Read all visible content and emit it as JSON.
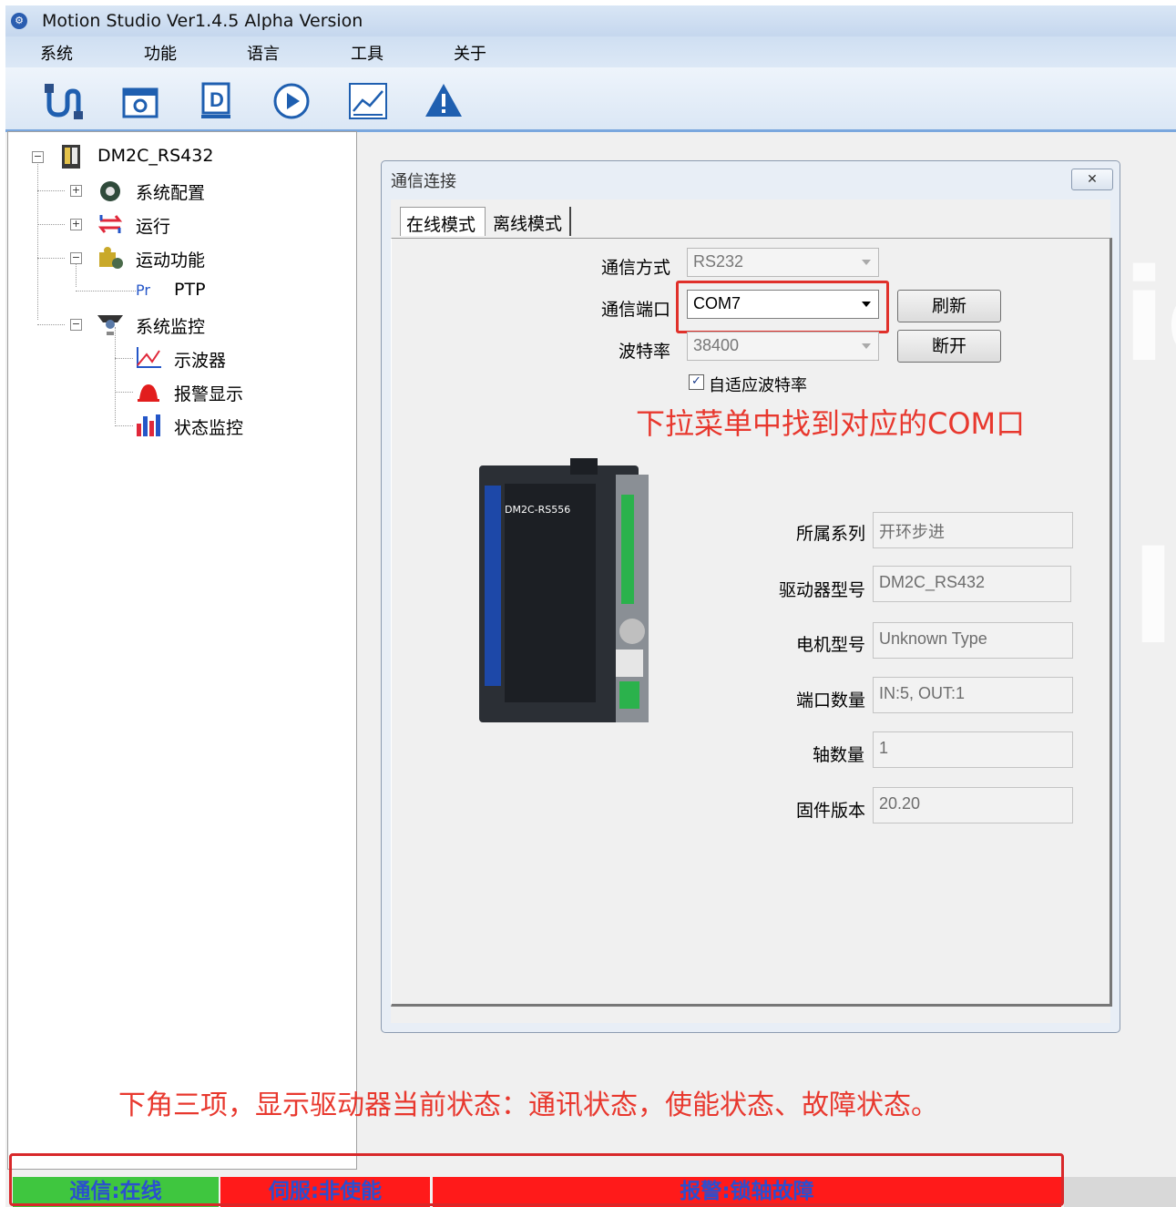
{
  "window": {
    "title": "Motion Studio  Ver1.4.5 Alpha Version",
    "app_icon": "motion-studio-logo"
  },
  "menu": {
    "items": [
      "系统",
      "功能",
      "语言",
      "工具",
      "关于"
    ]
  },
  "toolbar": {
    "icons": [
      "connect-icon",
      "device-settings-icon",
      "d-mode-icon",
      "run-icon",
      "chart-icon",
      "alarm-icon"
    ]
  },
  "tree": {
    "root": "DM2C_RS432",
    "items": {
      "sys_config": "系统配置",
      "run": "运行",
      "motion": "运动功能",
      "ptp_prefix": "Pr",
      "ptp": "PTP",
      "monitor": "系统监控",
      "scope": "示波器",
      "alarm_display": "报警显示",
      "status_monitor": "状态监控"
    }
  },
  "dialog": {
    "title": "通信连接",
    "close": "✕",
    "tabs": {
      "online": "在线模式",
      "offline": "离线模式"
    },
    "comm_mode": {
      "label": "通信方式",
      "value": "RS232"
    },
    "comm_port": {
      "label": "通信端口",
      "value": "COM7"
    },
    "baud": {
      "label": "波特率",
      "value": "38400"
    },
    "buttons": {
      "refresh": "刷新",
      "disconnect": "断开"
    },
    "auto_baud": {
      "label": "自适应波特率",
      "checked": true
    },
    "annotation": "下拉菜单中找到对应的COM口",
    "info": {
      "series": {
        "label": "所属系列",
        "value": "开环步进"
      },
      "driver_model": {
        "label": "驱动器型号",
        "value": "DM2C_RS432"
      },
      "motor_model": {
        "label": "电机型号",
        "value": "Unknown Type"
      },
      "ports": {
        "label": "端口数量",
        "value": "IN:5, OUT:1"
      },
      "axes": {
        "label": "轴数量",
        "value": "1"
      },
      "firmware": {
        "label": "固件版本",
        "value": "20.20"
      }
    },
    "device_label": "DM2C-RS556"
  },
  "bottom_annotation": "下角三项，显示驱动器当前状态：通讯状态，使能状态、故障状态。",
  "status": {
    "comm": "通信:在线",
    "servo": "伺服:非使能",
    "alarm": "报警:锁轴故障"
  },
  "colors": {
    "status_ok": "#3fc63f",
    "status_bad": "#ff1a1a",
    "annotation_red": "#e8382e",
    "highlight_red": "#e0302a"
  }
}
